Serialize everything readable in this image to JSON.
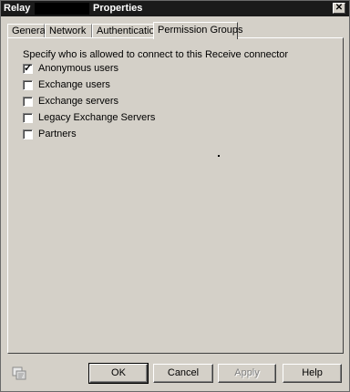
{
  "window": {
    "title_prefix": "Relay",
    "title_suffix": "Properties",
    "close_glyph": "✕"
  },
  "tabs": [
    {
      "label": "General",
      "active": false
    },
    {
      "label": "Network",
      "active": false
    },
    {
      "label": "Authentication",
      "active": false
    },
    {
      "label": "Permission Groups",
      "active": true
    }
  ],
  "permission_groups": {
    "instruction": "Specify who is allowed to connect to this Receive connector",
    "options": [
      {
        "label": "Anonymous users",
        "checked": true
      },
      {
        "label": "Exchange users",
        "checked": false
      },
      {
        "label": "Exchange servers",
        "checked": false
      },
      {
        "label": "Legacy Exchange Servers",
        "checked": false
      },
      {
        "label": "Partners",
        "checked": false
      }
    ]
  },
  "buttons": {
    "ok": "OK",
    "cancel": "Cancel",
    "apply": "Apply",
    "help": "Help"
  },
  "icons": {
    "bottom_left": "exchange-snapin-icon"
  }
}
